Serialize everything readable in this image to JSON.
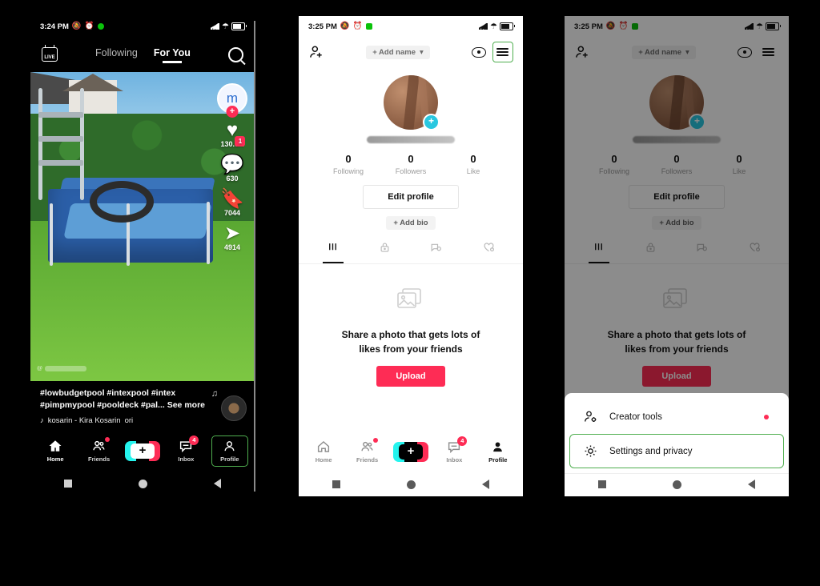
{
  "phone1": {
    "theme": "dark",
    "status": {
      "time": "3:24 PM",
      "icons": [
        "alarm-off-icon",
        "clock-icon",
        "green-dot-icon"
      ],
      "signal": "signal-icon",
      "wifi": "wifi-icon",
      "battery": "battery-icon"
    },
    "header": {
      "live_label": "LIVE",
      "tabs": [
        {
          "label": "Following",
          "active": false
        },
        {
          "label": "For You",
          "active": true
        }
      ],
      "search": "search-icon"
    },
    "video": {
      "watermark": "@",
      "rail": {
        "avatar_glyph": "m",
        "follow_plus": "+",
        "like_count": "130.6K",
        "comment_count": "630",
        "comment_badge": "1",
        "bookmark_count": "7044",
        "share_count": "4914"
      }
    },
    "caption": {
      "line1": "#lowbudgetpool #intexpool #intex",
      "line2": "#pimpmypool #pooldeck #pal...",
      "see_more": "See more",
      "music": "kosarin - Kira Kosarin",
      "music_extra": "ori"
    },
    "tabbar": [
      {
        "label": "Home",
        "icon": "home-icon",
        "selected": true,
        "badge": null,
        "dot": false,
        "highlight": false
      },
      {
        "label": "Friends",
        "icon": "friends-icon",
        "selected": false,
        "badge": null,
        "dot": true,
        "highlight": false
      },
      {
        "label": "",
        "icon": "create-plus-icon",
        "selected": false,
        "badge": null,
        "dot": false,
        "highlight": false
      },
      {
        "label": "Inbox",
        "icon": "inbox-icon",
        "selected": false,
        "badge": "4",
        "dot": false,
        "highlight": false
      },
      {
        "label": "Profile",
        "icon": "profile-icon",
        "selected": false,
        "badge": null,
        "dot": false,
        "highlight": true
      }
    ],
    "navbar": [
      "recents-square-icon",
      "home-circle-icon",
      "back-triangle-icon"
    ]
  },
  "phone2": {
    "theme": "light",
    "status": {
      "time": "3:25 PM",
      "icons": [
        "alarm-off-icon",
        "clock-icon",
        "green-square-icon"
      ],
      "signal": "signal-icon",
      "wifi": "wifi-icon",
      "battery": "battery-icon"
    },
    "header": {
      "add_friends_icon": "add-person-icon",
      "add_name": "+ Add name",
      "chevron": "chevron-down-icon",
      "eye_icon": "eye-icon",
      "menu_icon": "hamburger-menu-icon",
      "menu_highlighted": true
    },
    "profile": {
      "avatar_plus": "+",
      "stats": [
        {
          "value": "0",
          "label": "Following"
        },
        {
          "value": "0",
          "label": "Followers"
        },
        {
          "value": "0",
          "label": "Like"
        }
      ],
      "edit_profile": "Edit profile",
      "add_bio": "+ Add bio",
      "tabs": [
        {
          "icon": "grid-posts-icon",
          "active": true
        },
        {
          "icon": "private-lock-icon",
          "active": false
        },
        {
          "icon": "repost-icon",
          "active": false
        },
        {
          "icon": "liked-heart-icon",
          "active": false
        }
      ]
    },
    "empty": {
      "icon": "photos-placeholder-icon",
      "text_line1": "Share a photo that gets lots of",
      "text_line2": "likes from your friends",
      "upload_label": "Upload"
    },
    "tabbar": [
      {
        "label": "Home",
        "icon": "home-icon",
        "selected": false,
        "badge": null,
        "dot": false,
        "highlight": false
      },
      {
        "label": "Friends",
        "icon": "friends-icon",
        "selected": false,
        "badge": null,
        "dot": true,
        "highlight": false
      },
      {
        "label": "",
        "icon": "create-plus-icon",
        "selected": false,
        "badge": null,
        "dot": false,
        "highlight": false
      },
      {
        "label": "Inbox",
        "icon": "inbox-icon",
        "selected": false,
        "badge": "4",
        "dot": false,
        "highlight": false
      },
      {
        "label": "Profile",
        "icon": "profile-icon",
        "selected": true,
        "badge": null,
        "dot": false,
        "highlight": false
      }
    ],
    "navbar": [
      "recents-square-icon",
      "home-circle-icon",
      "back-triangle-icon"
    ]
  },
  "phone3": {
    "theme": "light",
    "dimmed": true,
    "status": {
      "time": "3:25 PM",
      "icons": [
        "alarm-off-icon",
        "clock-icon",
        "green-square-icon"
      ],
      "signal": "signal-icon",
      "wifi": "wifi-icon",
      "battery": "battery-icon"
    },
    "header": {
      "add_friends_icon": "add-person-icon",
      "add_name": "+ Add name",
      "chevron": "chevron-down-icon",
      "eye_icon": "eye-icon",
      "menu_icon": "hamburger-menu-icon"
    },
    "profile": {
      "avatar_plus": "+",
      "stats": [
        {
          "value": "0",
          "label": "Following"
        },
        {
          "value": "0",
          "label": "Followers"
        },
        {
          "value": "0",
          "label": "Like"
        }
      ],
      "edit_profile": "Edit profile",
      "add_bio": "+ Add bio",
      "tabs": [
        {
          "icon": "grid-posts-icon",
          "active": true
        },
        {
          "icon": "private-lock-icon",
          "active": false
        },
        {
          "icon": "repost-icon",
          "active": false
        },
        {
          "icon": "liked-heart-icon",
          "active": false
        }
      ]
    },
    "empty": {
      "icon": "photos-placeholder-icon",
      "text_line1": "Share a photo that gets lots of",
      "text_line2": "likes from your friends",
      "upload_label": "Upload"
    },
    "sheet": {
      "items": [
        {
          "label": "Creator tools",
          "icon": "creator-tools-icon",
          "dot": true,
          "highlight": false
        },
        {
          "label": "Settings and privacy",
          "icon": "settings-gear-icon",
          "dot": false,
          "highlight": true
        }
      ]
    },
    "navbar": [
      "recents-square-icon",
      "home-circle-icon",
      "back-triangle-icon"
    ]
  },
  "colors": {
    "accent_red": "#fe2c55",
    "accent_cyan": "#25f4ee",
    "highlight_green": "#4fae4f",
    "page_background": "#000000"
  }
}
